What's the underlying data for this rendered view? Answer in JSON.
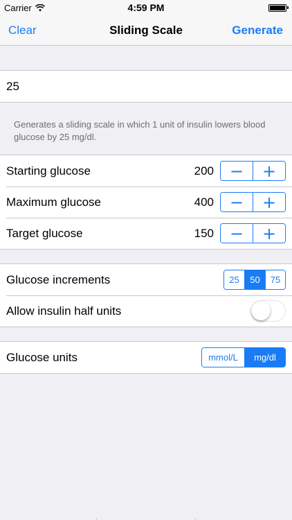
{
  "status_bar": {
    "carrier": "Carrier",
    "time": "4:59 PM"
  },
  "nav": {
    "clear_label": "Clear",
    "title": "Sliding Scale",
    "generate_label": "Generate"
  },
  "insulin_field": {
    "value": "25"
  },
  "description": "Generates a sliding scale in which 1 unit of insulin lowers blood glucose by 25 mg/dl.",
  "glucose_rows": [
    {
      "label": "Starting glucose",
      "value": "200"
    },
    {
      "label": "Maximum glucose",
      "value": "400"
    },
    {
      "label": "Target glucose",
      "value": "150"
    }
  ],
  "stepper": {
    "minus": "−",
    "plus": "+"
  },
  "increments": {
    "label": "Glucose increments",
    "options": [
      "25",
      "50",
      "75"
    ],
    "selected": "50"
  },
  "half_units": {
    "label": "Allow insulin half units",
    "enabled": false
  },
  "units": {
    "label": "Glucose units",
    "options": [
      "mmol/L",
      "mg/dl"
    ],
    "selected": "mg/dl"
  },
  "colors": {
    "accent": "#1a7cf5",
    "background": "#efeff4",
    "separator": "#c8c7cc",
    "secondary_text": "#6d6d72"
  },
  "icons": {
    "signal": "wifi-icon",
    "battery": "battery-icon"
  }
}
